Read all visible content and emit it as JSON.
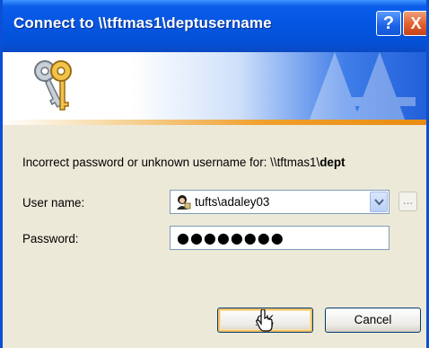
{
  "window": {
    "title": "Connect to \\\\tftmas1\\deptusername",
    "help_label": "?",
    "close_label": "X"
  },
  "message": {
    "text": "Incorrect password or unknown username for: \\\\tftmas1\\",
    "path_bold": "dept"
  },
  "fields": {
    "username_label": "User name:",
    "username_value": "tufts\\adaley03",
    "password_label": "Password:",
    "password_masked": "●●●●●●●●",
    "browse_label": "..."
  },
  "buttons": {
    "ok": "OK",
    "cancel": "Cancel"
  },
  "icons": {
    "banner": "keys-icon",
    "user": "user-icon",
    "dropdown": "chevron-down-icon",
    "cursor": "mouse-cursor-icon"
  },
  "colors": {
    "titlebar": "#0556e2",
    "window_bg": "#ece9d8",
    "accent_strip": "#f0a030"
  }
}
